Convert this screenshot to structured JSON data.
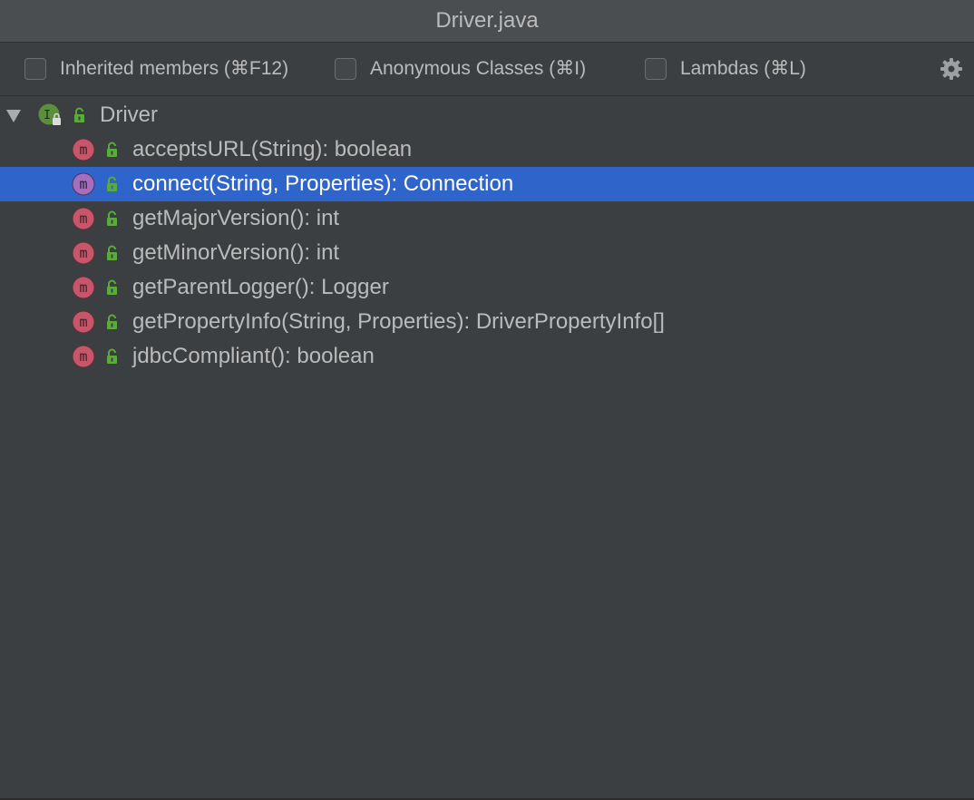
{
  "window": {
    "title": "Driver.java"
  },
  "toolbar": {
    "inherited_label": "Inherited members (⌘F12)",
    "anonymous_label": "Anonymous Classes (⌘I)",
    "lambdas_label": "Lambdas (⌘L)",
    "settings_icon": "gear-icon"
  },
  "tree": {
    "root": {
      "label": "Driver",
      "kind": "interface",
      "expanded": true
    },
    "methods": [
      {
        "label": "acceptsURL(String): boolean"
      },
      {
        "label": "connect(String, Properties): Connection",
        "selected": true
      },
      {
        "label": "getMajorVersion(): int"
      },
      {
        "label": "getMinorVersion(): int"
      },
      {
        "label": "getParentLogger(): Logger"
      },
      {
        "label": "getPropertyInfo(String, Properties): DriverPropertyInfo[]"
      },
      {
        "label": "jdbcCompliant(): boolean"
      }
    ]
  },
  "colors": {
    "background": "#3c3f41",
    "titlebar": "#4b4e50",
    "selection": "#2f65ca",
    "method_icon": "#c7566b",
    "method_icon_selected": "#a56fbd",
    "interface_icon": "#5a8f3c",
    "public_lock": "#5aaa3c"
  }
}
